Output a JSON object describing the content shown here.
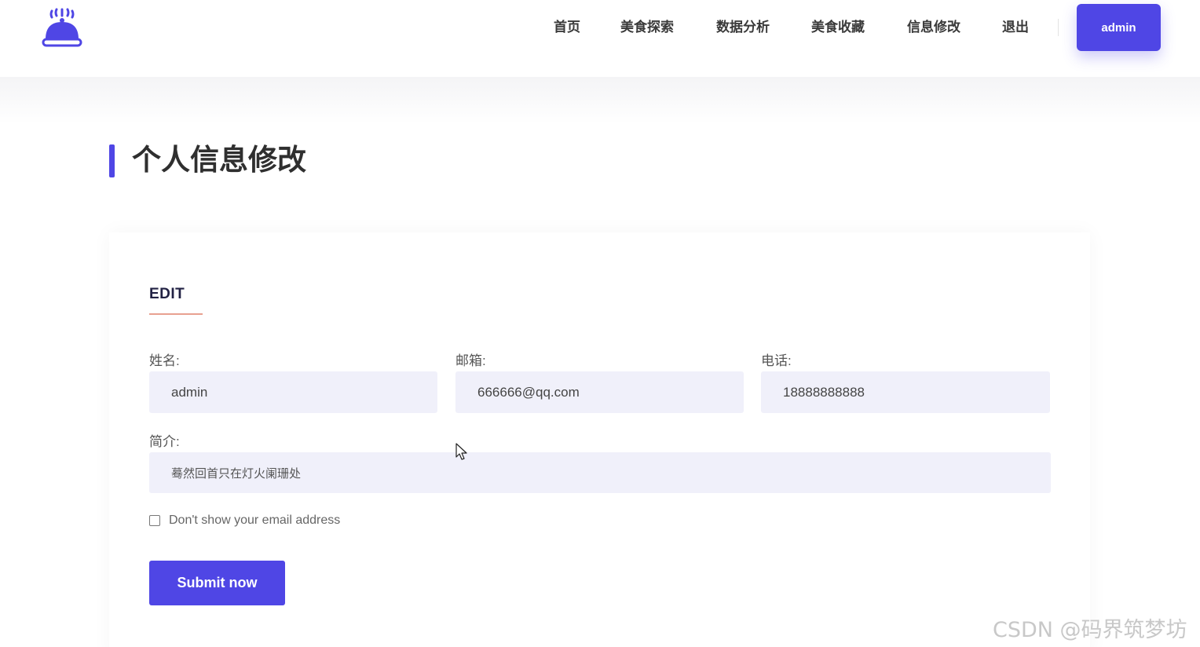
{
  "header": {
    "logo_icon": "cloche-icon",
    "nav": [
      {
        "label": "首页"
      },
      {
        "label": "美食探索"
      },
      {
        "label": "数据分析"
      },
      {
        "label": "美食收藏"
      },
      {
        "label": "信息修改"
      },
      {
        "label": "退出"
      }
    ],
    "user_button": "admin"
  },
  "page": {
    "title": "个人信息修改"
  },
  "form": {
    "heading": "EDIT",
    "name_label": "姓名:",
    "name_value": "admin",
    "email_label": "邮箱:",
    "email_value": "666666@qq.com",
    "phone_label": "电话:",
    "phone_value": "18888888888",
    "bio_label": "简介:",
    "bio_value": "蓦然回首只在灯火阑珊处",
    "checkbox_label": "Don't show your email address",
    "submit_label": "Submit now"
  },
  "watermark": "CSDN @码界筑梦坊",
  "colors": {
    "accent": "#4f46e5",
    "input_bg": "#f0f0fa",
    "underline": "#e8a090"
  }
}
